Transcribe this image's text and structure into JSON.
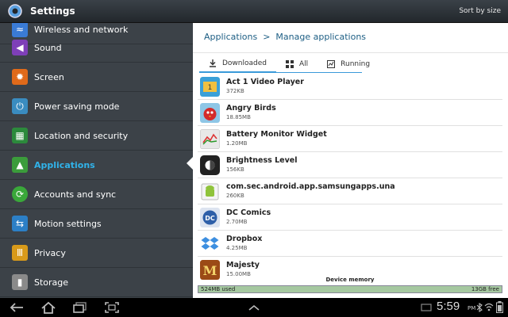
{
  "window": {
    "title": "Settings",
    "sort_label": "Sort by size"
  },
  "sidebar": {
    "items": [
      {
        "label": "Wireless and network",
        "icon": "wifi-icon",
        "color": "#3a7bd5"
      },
      {
        "label": "Sound",
        "icon": "speaker-icon",
        "color": "#7e3fb8"
      },
      {
        "label": "Screen",
        "icon": "screen-icon",
        "color": "#e06a1a"
      },
      {
        "label": "Power saving mode",
        "icon": "power-icon",
        "color": "#3a8cc0"
      },
      {
        "label": "Location and security",
        "icon": "location-icon",
        "color": "#2c8a3c"
      },
      {
        "label": "Applications",
        "icon": "applications-icon",
        "color": "#3b9c3b"
      },
      {
        "label": "Accounts and sync",
        "icon": "sync-icon",
        "color": "#3aa83a"
      },
      {
        "label": "Motion settings",
        "icon": "motion-icon",
        "color": "#2c7fc6"
      },
      {
        "label": "Privacy",
        "icon": "privacy-icon",
        "color": "#d89a1a"
      },
      {
        "label": "Storage",
        "icon": "storage-icon",
        "color": "#8a8a8a"
      }
    ],
    "active_index": 5
  },
  "breadcrumb": {
    "root": "Applications",
    "separator": ">",
    "current": "Manage applications"
  },
  "tabs": [
    {
      "label": "Downloaded",
      "icon": "download-icon",
      "active": true
    },
    {
      "label": "All",
      "icon": "grid-icon",
      "active": false
    },
    {
      "label": "Running",
      "icon": "running-icon",
      "active": false
    }
  ],
  "apps": [
    {
      "name": "Act 1 Video Player",
      "size": "372KB",
      "icon": "video-player-icon",
      "color": "#3aa0d8"
    },
    {
      "name": "Angry Birds",
      "size": "18.85MB",
      "icon": "angry-birds-icon",
      "color": "#d32a2a"
    },
    {
      "name": "Battery Monitor Widget",
      "size": "1.20MB",
      "icon": "battery-icon",
      "color": "#e8e8e8"
    },
    {
      "name": "Brightness Level",
      "size": "156KB",
      "icon": "brightness-icon",
      "color": "#222222"
    },
    {
      "name": "com.sec.android.app.samsungapps.una",
      "size": "260KB",
      "icon": "android-icon",
      "color": "#8fc33a"
    },
    {
      "name": "DC Comics",
      "size": "2.70MB",
      "icon": "dc-comics-icon",
      "color": "#2e5fa8"
    },
    {
      "name": "Dropbox",
      "size": "4.25MB",
      "icon": "dropbox-icon",
      "color": "#3d8fe0"
    },
    {
      "name": "Majesty",
      "size": "15.00MB",
      "icon": "majesty-icon",
      "color": "#9b4a16"
    }
  ],
  "memory": {
    "label": "Device memory",
    "used": "524MB used",
    "free": "13GB free"
  },
  "statusbar": {
    "time": "5:59",
    "ampm": "PM"
  }
}
